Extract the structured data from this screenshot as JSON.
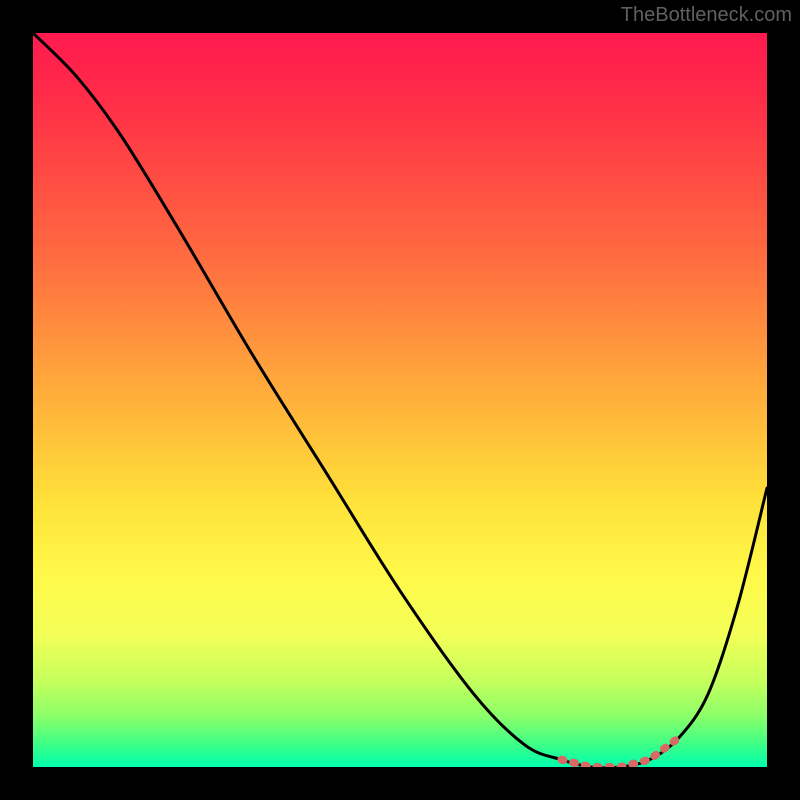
{
  "watermark": "TheBottleneck.com",
  "colors": {
    "page_bg": "#000000",
    "watermark_text": "#606060",
    "curve": "#000000",
    "trough_marker": "#d86a66",
    "gradient_top": "#ff1a4f",
    "gradient_bottom": "#00ffae"
  },
  "chart_data": {
    "type": "line",
    "title": "",
    "xlabel": "",
    "ylabel": "",
    "xlim": [
      0,
      100
    ],
    "ylim": [
      0,
      100
    ],
    "x": [
      0,
      6,
      12,
      20,
      30,
      40,
      50,
      60,
      67,
      72,
      76,
      80,
      84,
      88,
      92,
      96,
      100
    ],
    "values": [
      100,
      94,
      86,
      73,
      56,
      40,
      24,
      10,
      3,
      1,
      0,
      0,
      1,
      4,
      10,
      22,
      38
    ],
    "trough_range_x": [
      70,
      86
    ],
    "trough_value": 0,
    "annotations": [],
    "legend": []
  }
}
